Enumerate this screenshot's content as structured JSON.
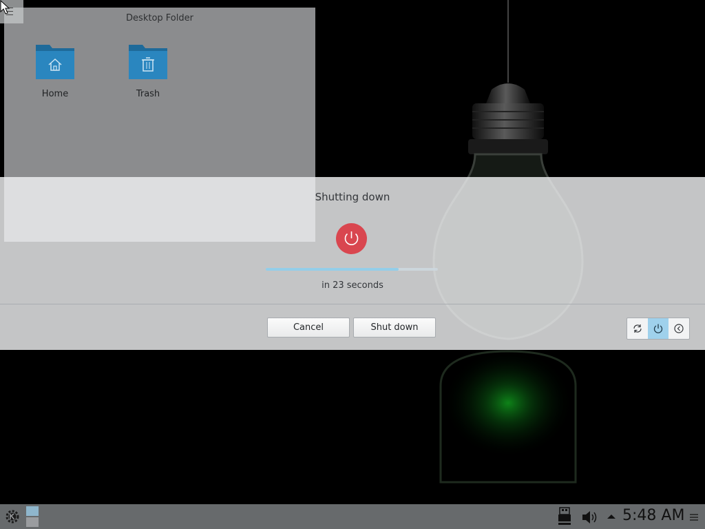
{
  "desktop_folder": {
    "title": "Desktop Folder",
    "items": [
      {
        "label": "Home",
        "icon": "home-folder-icon"
      },
      {
        "label": "Trash",
        "icon": "trash-folder-icon"
      }
    ]
  },
  "logout_dialog": {
    "title": "Shutting down",
    "countdown": "in 23 seconds",
    "progress_fraction": 0.77,
    "cancel_label": "Cancel",
    "confirm_label": "Shut down",
    "actions": [
      {
        "icon": "restart-icon",
        "active": false
      },
      {
        "icon": "power-icon",
        "active": true
      },
      {
        "icon": "logout-icon",
        "active": false
      }
    ]
  },
  "taskbar": {
    "clock": "5:48 AM",
    "tray": [
      "device-notifier-icon",
      "volume-icon",
      "tray-expand-arrow-icon"
    ]
  },
  "colors": {
    "accent": "#93cee9",
    "power_red": "#d9464f",
    "active_action": "#9fd1ec"
  }
}
